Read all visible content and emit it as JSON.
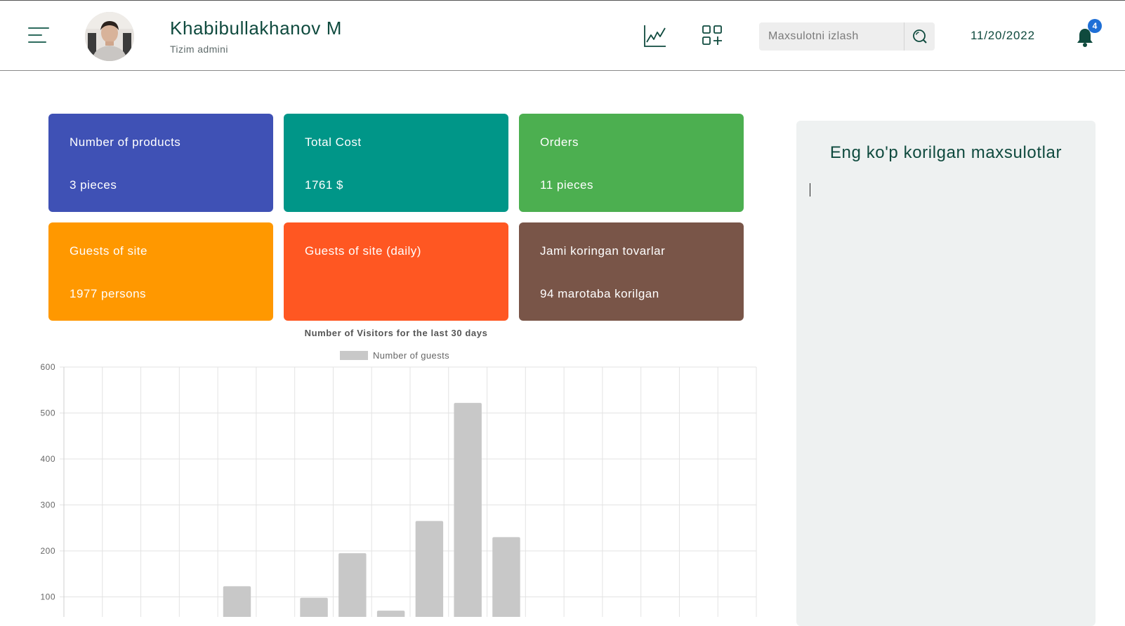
{
  "header": {
    "user_name": "Khabibullakhanov M",
    "user_role": "Tizim admini",
    "search_placeholder": "Maxsulotni izlash",
    "date": "11/20/2022",
    "notification_count": "4",
    "icons": [
      "menu-icon",
      "avatar",
      "line-chart-icon",
      "add-grid-icon",
      "search-icon",
      "bell-icon"
    ]
  },
  "cards": [
    {
      "title": "Number of products",
      "value": "3 pieces",
      "color": "#3f51b5"
    },
    {
      "title": "Total Cost",
      "value": "1761 $",
      "color": "#009688"
    },
    {
      "title": "Orders",
      "value": "11 pieces",
      "color": "#4caf50"
    },
    {
      "title": "Guests of site",
      "value": "1977 persons",
      "color": "#ff9800"
    },
    {
      "title": "Guests of site (daily)",
      "value": "",
      "color": "#ff5722"
    },
    {
      "title": "Jami koringan tovarlar",
      "value": "94 marotaba korilgan",
      "color": "#795548"
    }
  ],
  "side_panel": {
    "title": "Eng ko'p korilgan maxsulotlar"
  },
  "chart_data": {
    "type": "bar",
    "title": "Number of Visitors for the last 30 days",
    "legend": "Number of guests",
    "legend_position": "top",
    "ylim": [
      0,
      600
    ],
    "yticks": [
      "100",
      "200",
      "300",
      "400",
      "500",
      "600"
    ],
    "grid": true,
    "bar_color": "#c8c8c8",
    "series": [
      {
        "name": "Number of guests",
        "values": [
          0,
          5,
          0,
          0,
          123,
          0,
          98,
          195,
          70,
          265,
          522,
          230,
          0,
          5,
          0,
          0,
          0,
          0
        ]
      }
    ]
  }
}
